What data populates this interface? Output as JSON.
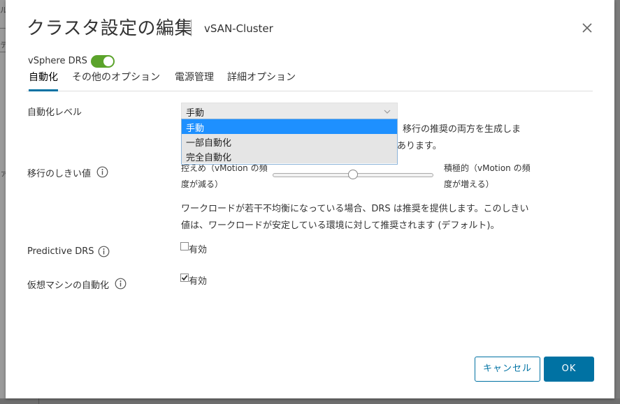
{
  "background": {
    "frag1": "ル",
    "frag2": "テ",
    "frag3": "ァ"
  },
  "dialog": {
    "title": "クラスタ設定の編集",
    "subtitle": "vSAN-Cluster"
  },
  "drs": {
    "label": "vSphere DRS",
    "enabled": true,
    "toggle_color": "#5ba32b"
  },
  "tabs": [
    {
      "label": "自動化",
      "active": true
    },
    {
      "label": "その他のオプション",
      "active": false
    },
    {
      "label": "電源管理",
      "active": false
    },
    {
      "label": "詳細オプション",
      "active": false
    }
  ],
  "automation_level": {
    "label": "自動化レベル",
    "selected": "手動",
    "options": [
      "手動",
      "一部自動化",
      "完全自動化"
    ],
    "desc_line1": "移行の推奨の両方を生成しま",
    "desc_line2": "あります。"
  },
  "migration_threshold": {
    "label": "移行のしきい値",
    "left_label_line1": "控えめ（vMotion の頻",
    "left_label_line2": "度が減る）",
    "right_label_line1": "積極的（vMotion の頻",
    "right_label_line2": "度が増える）",
    "level": 0.5,
    "desc_line1": "ワークロードが若干不均衡になっている場合、DRS は推奨を提供します。このしきい",
    "desc_line2": "値は、ワークロードが安定している環境に対して推奨されます (デフォルト)。"
  },
  "predictive_drs": {
    "label": "Predictive DRS",
    "checkbox_label": "有効",
    "checked": false
  },
  "vm_automation": {
    "label": "仮想マシンの自動化",
    "checkbox_label": "有効",
    "checked": true
  },
  "buttons": {
    "cancel": "キャンセル",
    "ok": "OK"
  },
  "colors": {
    "accent": "#0072a3",
    "dropdown_selected": "#1e90ff"
  }
}
